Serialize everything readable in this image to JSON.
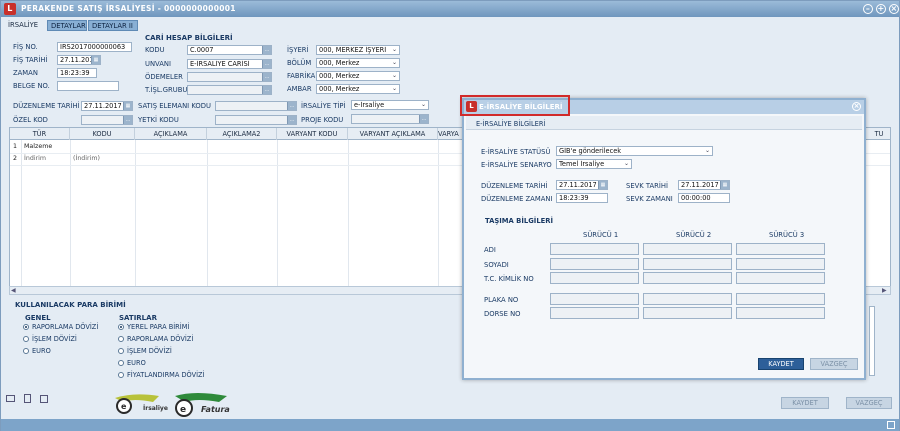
{
  "title": "PERAKENDE SATIŞ İRSALİYESİ - 0000000000001",
  "tabs": [
    "İRSALİYE",
    "DETAYLAR",
    "DETAYLAR II"
  ],
  "fis": {
    "no_label": "FİŞ NO.",
    "no": "IRS2017000000063",
    "tarih_label": "FİŞ TARİHİ",
    "tarih": "27.11.2017",
    "zaman_label": "ZAMAN",
    "zaman": "18:23:39",
    "belge_label": "BELGE NO."
  },
  "cari": {
    "section": "CARİ HESAP BİLGİLERİ",
    "kodu_label": "KODU",
    "kodu": "C.0007",
    "unvani_label": "UNVANI",
    "unvani": "E-İRSALİYE CARİSİ",
    "odemeler_label": "ÖDEMELER",
    "tisl_label": "T.İŞL.GRUBU"
  },
  "org": {
    "isyeri_label": "İŞYERİ",
    "isyeri": "000, MERKEZ İŞYERİ",
    "bolum_label": "BÖLÜM",
    "bolum": "000, Merkez",
    "fabrika_label": "FABRİKA",
    "fabrika": "000, Merkez",
    "ambar_label": "AMBAR",
    "ambar": "000, Merkez"
  },
  "row2": {
    "duzenleme_label": "DÜZENLEME TARİHİ",
    "duzenleme": "27.11.2017",
    "satis_label": "SATIŞ ELEMANI KODU",
    "irs_tipi_label": "İRSALİYE TİPİ",
    "irs_tipi": "e-İrsaliye",
    "ozel_label": "ÖZEL KOD",
    "yetki_label": "YETKİ KODU",
    "proje_label": "PROJE KODU"
  },
  "grid": {
    "headers": [
      "TÜR",
      "KODU",
      "AÇIKLAMA",
      "AÇIKLAMA2",
      "VARYANT KODU",
      "VARYANT AÇIKLAMA",
      "VARYA"
    ],
    "extra_header": "TU",
    "rows": [
      {
        "no": "1",
        "tur": "Malzeme",
        "kodu": ""
      },
      {
        "no": "2",
        "tur": "İndirim",
        "kodu": "(İndirim)"
      }
    ]
  },
  "para": {
    "section": "KULLANILACAK PARA BİRİMİ",
    "genel": "GENEL",
    "genel_opts": [
      "RAPORLAMA DÖVİZİ",
      "İŞLEM DÖVİZİ",
      "EURO"
    ],
    "satirlar": "SATIRLAR",
    "satir_opts": [
      "YEREL PARA BİRİMİ",
      "RAPORLAMA DÖVİZİ",
      "İŞLEM DÖVİZİ",
      "EURO",
      "FİYATLANDIRMA DÖVİZİ"
    ]
  },
  "logos": {
    "eirsaliye_text": "İrsaliye",
    "efatura_text": "Fatura"
  },
  "buttons": {
    "kaydet": "KAYDET",
    "vazgec": "VAZGEÇ"
  },
  "dialog": {
    "title": "E-İRSALİYE BİLGİLERİ",
    "subtitle": "E-İRSALİYE BİLGİLERİ",
    "statu_label": "E-İRSALİYE STATÜSÜ",
    "statu": "GİB'e gönderilecek",
    "senaryo_label": "E-İRSALİYE SENARYO",
    "senaryo": "Temel İrsaliye",
    "dtarih_label": "DÜZENLEME TARİHİ",
    "dtarih": "27.11.2017",
    "dzaman_label": "DÜZENLEME ZAMANI",
    "dzaman": "18:23:39",
    "starih_label": "SEVK TARİHİ",
    "starih": "27.11.2017",
    "szaman_label": "SEVK ZAMANI",
    "szaman": "00:00:00",
    "tasima": "TAŞIMA BİLGİLERİ",
    "drivers": [
      "SÜRÜCÜ 1",
      "SÜRÜCÜ 2",
      "SÜRÜCÜ 3"
    ],
    "rows": [
      "ADI",
      "SOYADI",
      "T.C. KİMLİK NO"
    ],
    "plaka": "PLAKA NO",
    "dorse": "DORSE NO",
    "kaydet": "KAYDET",
    "vazgec": "VAZGEÇ"
  }
}
